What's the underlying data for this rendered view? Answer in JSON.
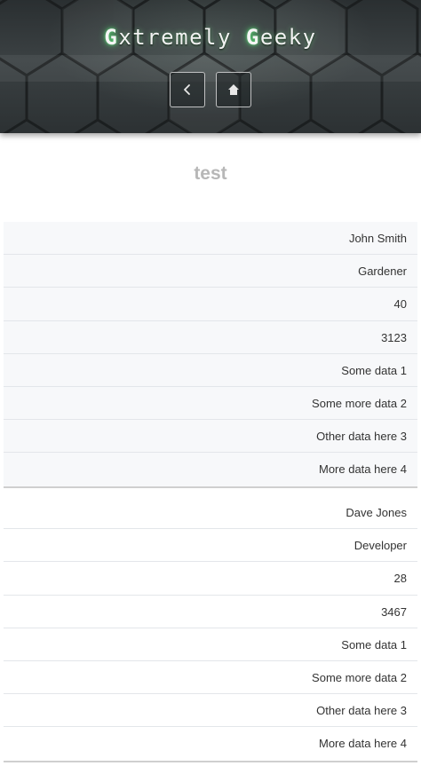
{
  "header": {
    "logo": {
      "first_mark": "G",
      "first_word": "xtremely",
      "second_mark": "G",
      "second_word": "eeky"
    },
    "back_icon": "chevron-left-icon",
    "home_icon": "home-icon",
    "accent_color": "#5ee67a"
  },
  "page": {
    "title": "test"
  },
  "records": [
    {
      "fields": [
        "John Smith",
        "Gardener",
        "40",
        "3123",
        "Some data 1",
        "Some more data 2",
        "Other data here 3",
        "More data here 4"
      ]
    },
    {
      "fields": [
        "Dave Jones",
        "Developer",
        "28",
        "3467",
        "Some data 1",
        "Some more data 2",
        "Other data here 3",
        "More data here 4"
      ]
    }
  ]
}
